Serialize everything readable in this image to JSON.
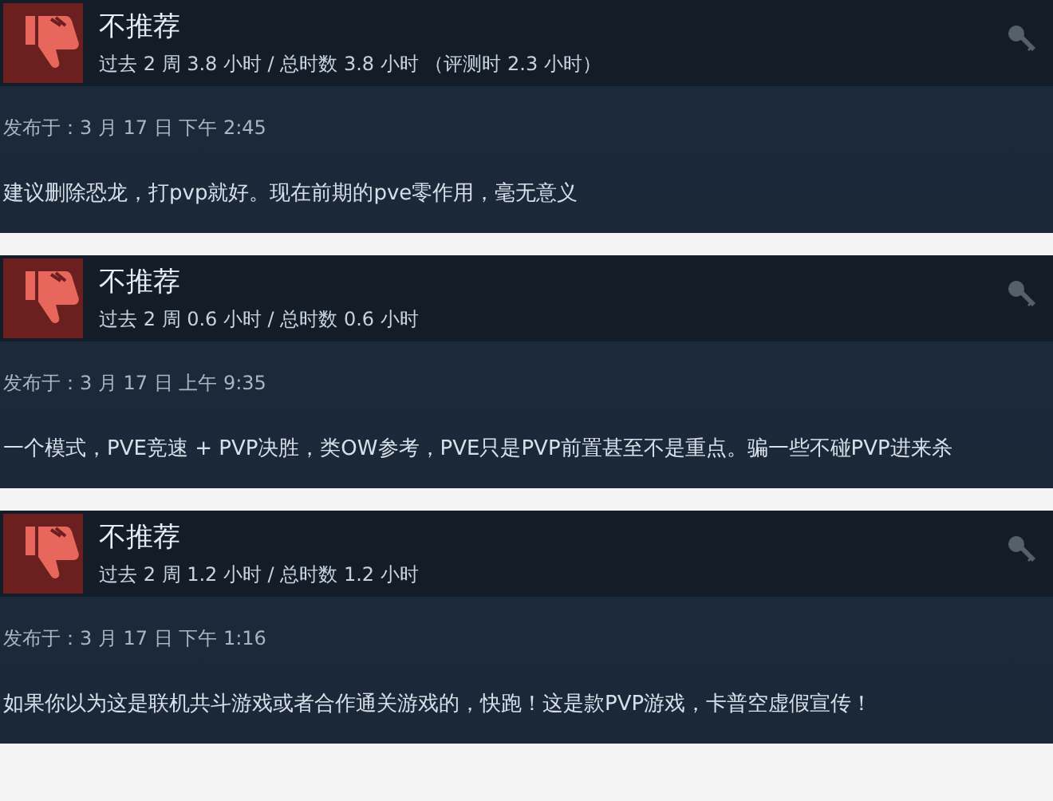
{
  "reviews": [
    {
      "recommended": false,
      "verdict": "不推荐",
      "hours": "过去 2 周 3.8 小时 / 总时数 3.8 小时 （评测时 2.3 小时）",
      "posted": "发布于：3 月 17 日 下午 2:45",
      "text": "建议删除恐龙，打pvp就好。现在前期的pve零作用，毫无意义"
    },
    {
      "recommended": false,
      "verdict": "不推荐",
      "hours": "过去 2 周 0.6 小时 / 总时数 0.6 小时",
      "posted": "发布于：3 月 17 日 上午 9:35",
      "text": "一个模式，PVE竞速 + PVP决胜，类OW参考，PVE只是PVP前置甚至不是重点。骗一些不碰PVP进来杀"
    },
    {
      "recommended": false,
      "verdict": "不推荐",
      "hours": "过去 2 周 1.2 小时 / 总时数 1.2 小时",
      "posted": "发布于：3 月 17 日 下午 1:16",
      "text": "如果你以为这是联机共斗游戏或者合作通关游戏的，快跑！这是款PVP游戏，卡普空虚假宣传！"
    }
  ]
}
